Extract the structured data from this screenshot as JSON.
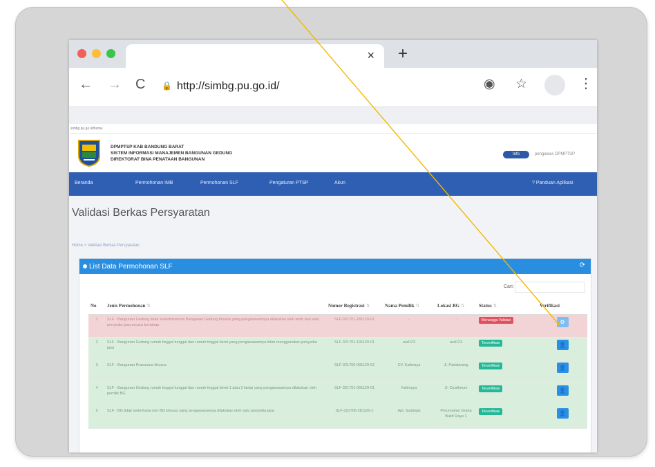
{
  "browser": {
    "tab_close": "×",
    "new_tab": "+",
    "url": "http://simbg.pu.go.id/",
    "icons": [
      "back-icon",
      "forward-icon",
      "reload-icon",
      "lock-icon",
      "location-icon",
      "star-icon",
      "avatar",
      "menu-icon"
    ],
    "glyphs": {
      "back": "←",
      "forward": "→",
      "reload": "C",
      "lock": "🔒",
      "location": "◉",
      "star": "☆",
      "menu": "⋮"
    },
    "dot_colors": [
      "#f25f58",
      "#fbbe3c",
      "#38c54c"
    ]
  },
  "site": {
    "topstrip": "simbg.pu.go.id/home",
    "header_lines": [
      "DPMPTSP KAB BANDUNG BARAT",
      "SISTEM INFORMASI MANAJEMEN BANGUNAN GEDUNG",
      "DIREKTORAT BINA PENATAAN BANGUNAN"
    ],
    "info_pill": "Info",
    "user_text": "pengawas DPMPTSP",
    "nav": [
      "Beranda",
      "Permohonan IMB",
      "Permohonan SLF",
      "Pengaturan PTSP",
      "Akun"
    ],
    "nav_right": "? Panduan Aplikasi"
  },
  "page": {
    "title": "Validasi Berkas Persyaratan",
    "breadcrumb": "Home > Validasi Berkas Persyaratan",
    "panel_title": "List Data Permohonan SLF",
    "search_label": "Cari:"
  },
  "table": {
    "headers": [
      "No",
      "Jenis Permohonan",
      "Nomor Registrasi",
      "Nama Pemilik",
      "Lokasi BG",
      "Status",
      "Verifikasi"
    ],
    "rows": [
      {
        "no": "1",
        "jenis": "SLF - Bangunan Gedung tidak sederhana/non Bangunan Gedung khusus yang pengawasannya dilakukan oleh lebih dari satu penyedia jasa secara bertahap",
        "reg": "SLF-321701-281120-01",
        "pemilik": "-",
        "lokasi": "-",
        "status": "Menunggu Validasi",
        "type": "red"
      },
      {
        "no": "2",
        "jenis": "SLF - Bangunan Gedung rumah tinggal tunggal dan rumah tinggal deret yang pengawasannya tidak menggunakan penyedia jasa",
        "reg": "SLF-321701-191120-01",
        "pemilik": "asd123",
        "lokasi": "asd123",
        "status": "Terverifikasi",
        "type": "green"
      },
      {
        "no": "3",
        "jenis": "SLF - Bangunan Prasarana khusus",
        "reg": "SLF-321706-091120-02",
        "pemilik": "CV. Kalimaya",
        "lokasi": "Jl. Padalarang",
        "status": "Terverifikasi",
        "type": "green"
      },
      {
        "no": "4",
        "jenis": "SLF - Bangunan Gedung rumah tinggal tunggal dan rumah tinggal deret 1 atau 2 lantai yang pengawasannya dilakukan oleh pemilik BG",
        "reg": "SLF-321701-091120-01",
        "pemilik": "Kalimaya",
        "lokasi": "Jl. Cicalheum",
        "status": "Terverifikasi",
        "type": "green"
      },
      {
        "no": "5",
        "jenis": "SLF - BG tidak sederhana non BG khusus yang pengawasannya dilakukan oleh satu penyedia jasa",
        "reg": "SLF-321706-281120-1",
        "pemilik": "Apt. Sudirajat",
        "lokasi": "Perumahan Graha Bukit Raya 1",
        "status": "Terverifikasi",
        "type": "green"
      }
    ]
  },
  "colors": {
    "nav_blue": "#2f5fb3",
    "panel_blue": "#2a8ee0",
    "badge_red": "#e0505f",
    "badge_green": "#24b896",
    "btn_blue": "#2b8fe3",
    "pointer_line": "#f2b800"
  }
}
